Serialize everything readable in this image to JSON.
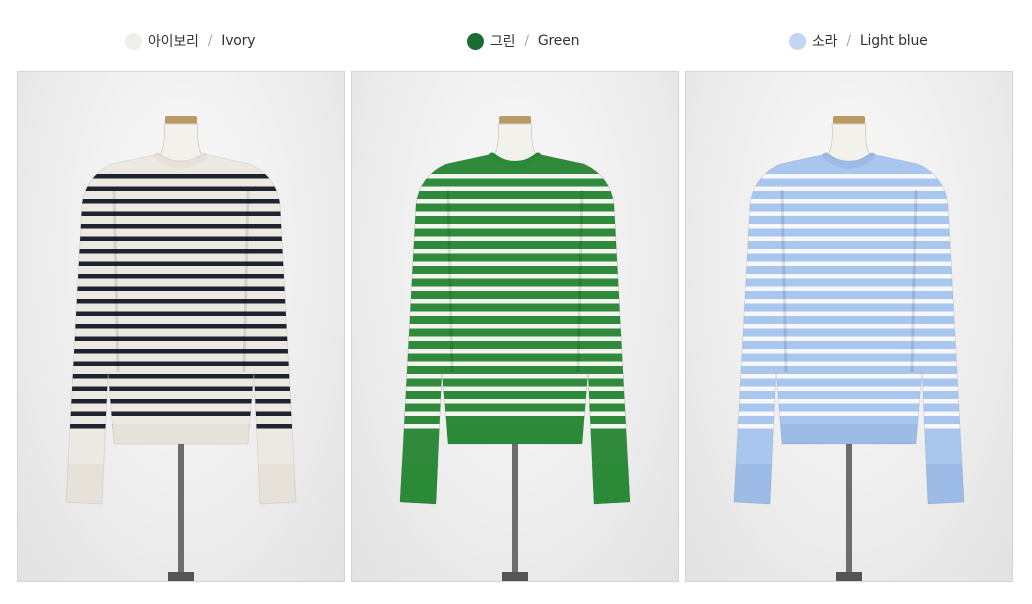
{
  "colors": [
    {
      "korean": "아이보리",
      "separator": "/",
      "english": "Ivory",
      "swatch": "#eeeeec",
      "base": "#ece9e2",
      "stripe": "#1f2330",
      "rib": "#e6e2d9"
    },
    {
      "korean": "그린",
      "separator": "/",
      "english": "Green",
      "swatch": "#1c6b32",
      "base": "#2f8a3c",
      "stripe": "#f4f4ee",
      "rib": "#2a8a38"
    },
    {
      "korean": "소라",
      "separator": "/",
      "english": "Light blue",
      "swatch": "#c2d5f2",
      "base": "#a9c6ee",
      "stripe": "#f6f8fc",
      "rib": "#9cbbe6"
    }
  ]
}
